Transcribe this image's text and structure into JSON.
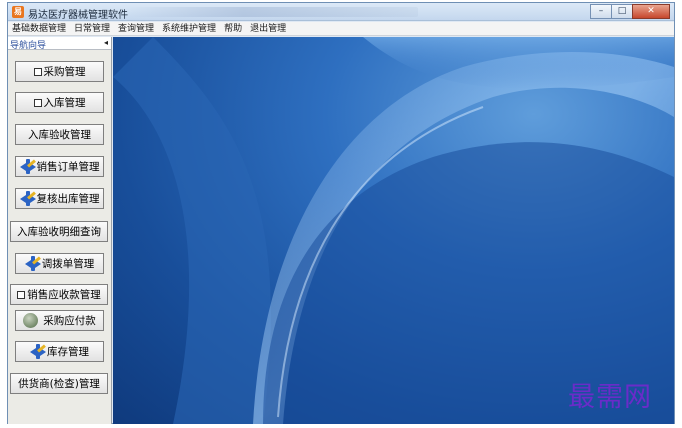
{
  "window": {
    "title": "易达医疗器械管理软件",
    "controls": {
      "minimize": "–",
      "maximize": "□",
      "close": "✕"
    }
  },
  "menubar": {
    "items": [
      "基础数据管理",
      "日常管理",
      "查询管理",
      "系统维护管理",
      "帮助",
      "退出管理"
    ]
  },
  "sidebar": {
    "header": "导航向导",
    "collapse_glyph": "◂",
    "buttons": [
      {
        "label": "采购管理",
        "icon": "small-window-icon"
      },
      {
        "label": "入库管理",
        "icon": "small-window-icon"
      },
      {
        "label": "入库验收管理",
        "icon": "none"
      },
      {
        "label": "销售订单管理",
        "icon": "arrows-icon"
      },
      {
        "label": "复核出库管理",
        "icon": "arrows-icon"
      },
      {
        "label": "入库验收明细查询",
        "icon": "none"
      },
      {
        "label": "调拨单管理",
        "icon": "arrows-icon"
      },
      {
        "label": "销售应收款管理",
        "icon": "small-window-icon"
      },
      {
        "label": "采购应付款",
        "icon": "money-bag-icon"
      },
      {
        "label": "库存管理",
        "icon": "arrows-icon"
      },
      {
        "label": "供货商(检查)管理",
        "icon": "none"
      }
    ]
  },
  "watermark": {
    "text": "最需网"
  },
  "colors": {
    "desktop": "#1f5aa8",
    "watermark": "#6a2cc9",
    "accent": "#2b63c4"
  }
}
